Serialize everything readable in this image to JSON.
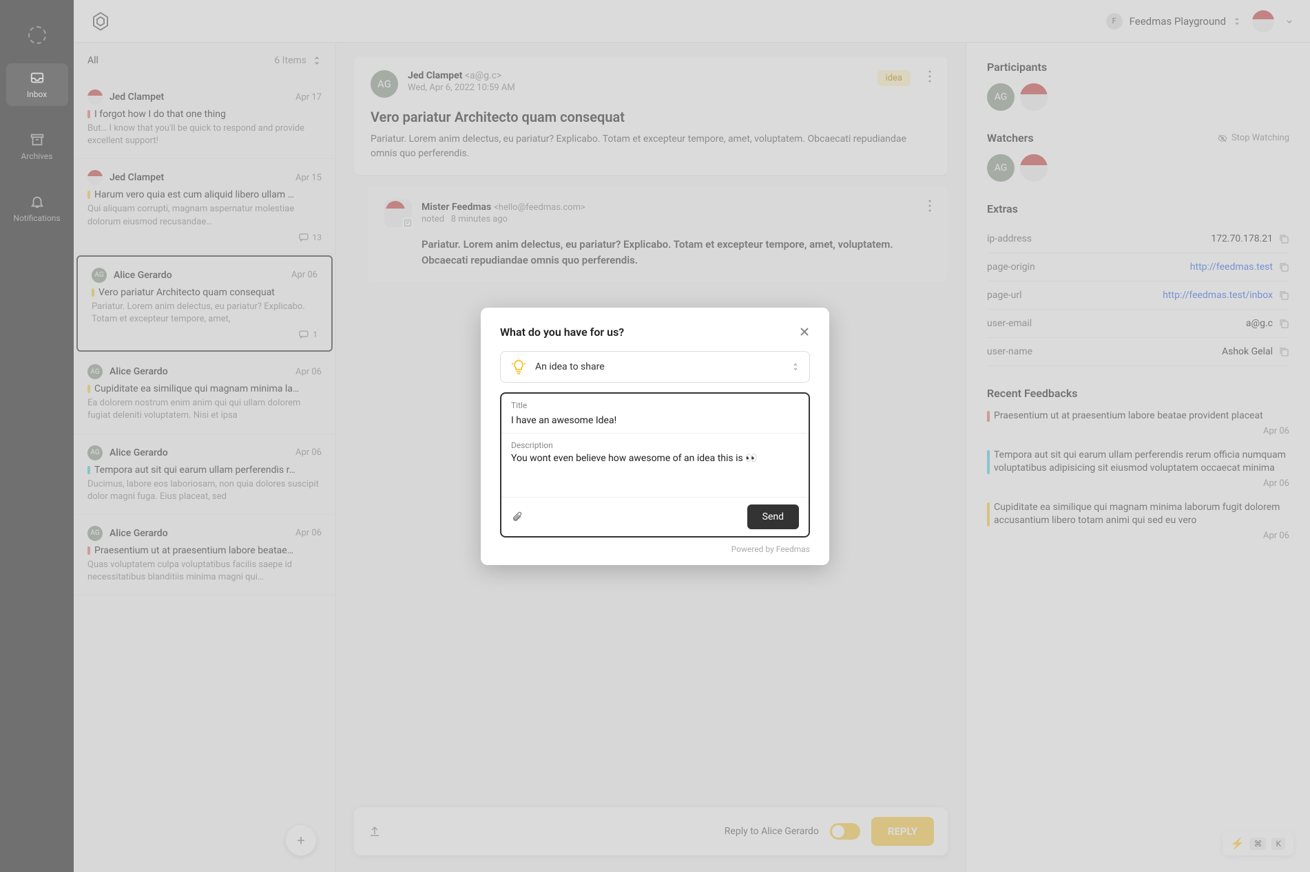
{
  "nav": {
    "items": [
      {
        "label": "Inbox",
        "icon": "inbox-icon",
        "active": true
      },
      {
        "label": "Archives",
        "icon": "archive-icon",
        "active": false
      },
      {
        "label": "Notifications",
        "icon": "bell-icon",
        "active": false
      }
    ]
  },
  "topbar": {
    "workspace_name": "Feedmas Playground",
    "workspace_initial": "F"
  },
  "list": {
    "filter_label": "All",
    "count_label": "6 Items",
    "items": [
      {
        "author": "Jed Clampet",
        "initials": "",
        "date": "Apr 17",
        "title": "I forgot how I do that one thing",
        "excerpt": "But… I know that you'll be quick to respond and provide excellent support!",
        "color": "red"
      },
      {
        "author": "Jed Clampet",
        "initials": "",
        "date": "Apr 15",
        "title": "Harum vero quia est cum aliquid libero ullam …",
        "excerpt": "Qui aliquam corrupti, magnam aspernatur molestiae dolorum eiusmod recusandae…",
        "color": "yellow",
        "comments": "13"
      },
      {
        "author": "Alice Gerardo",
        "initials": "AG",
        "date": "Apr 06",
        "title": "Vero pariatur Architecto quam consequat",
        "excerpt": "Pariatur. Lorem anim delectus, eu pariatur? Explicabo. Totam et excepteur tempore, amet,",
        "color": "yellow",
        "comments": "1",
        "selected": true
      },
      {
        "author": "Alice Gerardo",
        "initials": "AG",
        "date": "Apr 06",
        "title": "Cupiditate ea similique qui magnam minima la…",
        "excerpt": "Ea dolorem nostrum enim anim qui qui ullam dolorem fugiat deleniti voluptatem. Nisi et ipsa",
        "color": "yellow"
      },
      {
        "author": "Alice Gerardo",
        "initials": "AG",
        "date": "Apr 06",
        "title": "Tempora aut sit qui earum ullam perferendis r…",
        "excerpt": "Ducimus, labore eos laboriosam, non quia dolores suscipit dolor magni fuga. Eius placeat, sed",
        "color": "teal"
      },
      {
        "author": "Alice Gerardo",
        "initials": "AG",
        "date": "Apr 06",
        "title": "Praesentium ut at praesentium labore beatae…",
        "excerpt": "Quas voluptatem culpa voluptatibus facilis saepe id necessitatibus blanditiis minima magni qui…",
        "color": "red"
      }
    ]
  },
  "thread": {
    "from_name": "Jed Clampet",
    "from_email": "<a@g.c>",
    "from_initials": "AG",
    "date": "Wed, Apr 6, 2022 10:59 AM",
    "badge": "idea",
    "subject": "Vero pariatur Architecto quam consequat",
    "body": "Pariatur. Lorem anim delectus, eu pariatur? Explicabo. Totam et excepteur tempore, amet, voluptatem. Obcaecati repudiandae omnis quo perferendis.",
    "note": {
      "from_name": "Mister Feedmas",
      "from_email": "<hello@feedmas.com>",
      "meta_label": "noted",
      "meta_time": "8 minutes ago",
      "body": "Pariatur. Lorem anim delectus, eu pariatur? Explicabo. Totam et excepteur tempore, amet, voluptatem. Obcaecati repudiandae omnis quo perferendis."
    },
    "reply_to": "Reply to Alice Gerardo",
    "reply_btn": "REPLY"
  },
  "side": {
    "participants_title": "Participants",
    "watchers_title": "Watchers",
    "stop_watching": "Stop Watching",
    "extras_title": "Extras",
    "extras": [
      {
        "key": "ip-address",
        "value": "172.70.178.21",
        "link": false
      },
      {
        "key": "page-origin",
        "value": "http://feedmas.test",
        "link": true
      },
      {
        "key": "page-url",
        "value": "http://feedmas.test/inbox",
        "link": true
      },
      {
        "key": "user-email",
        "value": "a@g.c",
        "link": false
      },
      {
        "key": "user-name",
        "value": "Ashok Gelal",
        "link": false
      }
    ],
    "recent_title": "Recent Feedbacks",
    "recent": [
      {
        "title": "Praesentium ut at praesentium labore beatae provident placeat",
        "date": "Apr 06",
        "color": "red"
      },
      {
        "title": "Tempora aut sit qui earum ullam perferendis rerum officia numquam voluptatibus adipisicing sit eiusmod voluptatem occaecat minima",
        "date": "Apr 06",
        "color": "teal"
      },
      {
        "title": "Cupiditate ea similique qui magnam minima laborum fugit dolorem accusantium libero totam animi qui sed eu vero",
        "date": "Apr 06",
        "color": "yellow"
      }
    ]
  },
  "modal": {
    "heading": "What do you have for us?",
    "type_label": "An idea to share",
    "title_label": "Title",
    "title_value": "I have an awesome Idea!",
    "desc_label": "Description",
    "desc_value": "You wont even believe how awesome of an idea this is 👀",
    "send_label": "Send",
    "powered": "Powered by Feedmas"
  },
  "cmd": {
    "key1": "⌘",
    "key2": "K"
  }
}
